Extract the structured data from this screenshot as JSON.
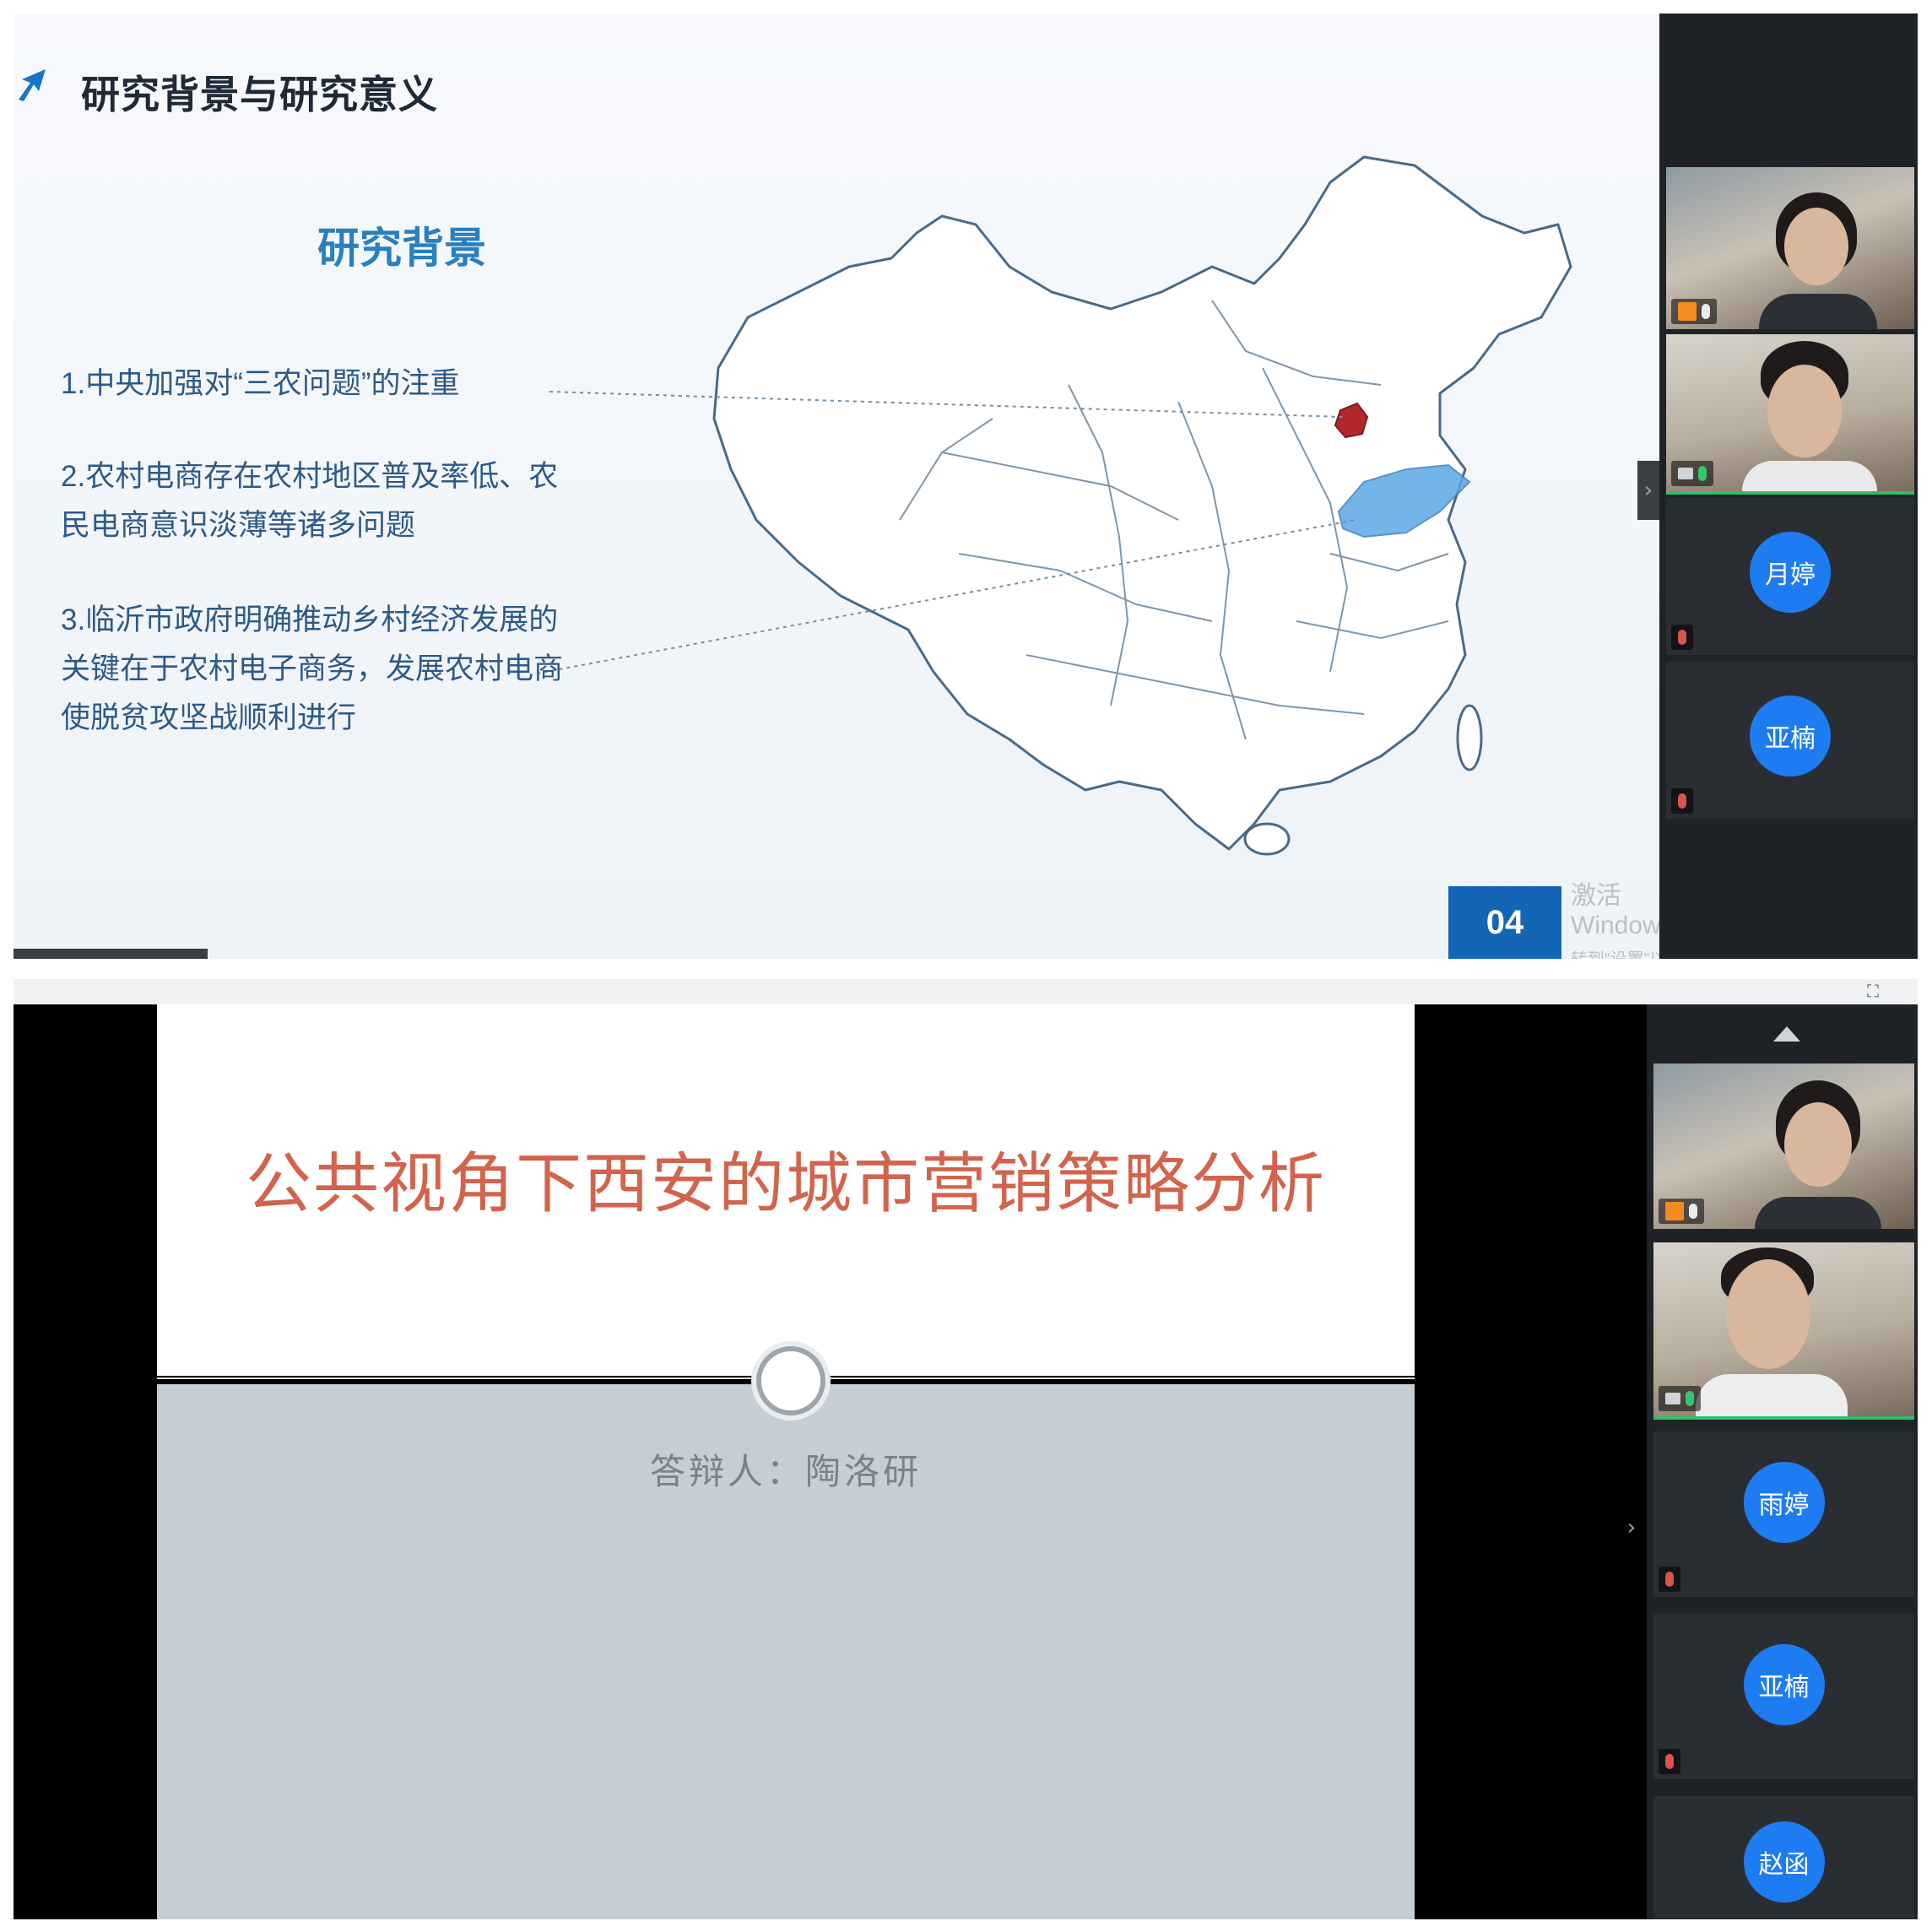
{
  "top_screen": {
    "slide": {
      "title": "研究背景与研究意义",
      "section_title": "研究背景",
      "bullets": [
        "1.中央加强对“三农问题”的注重",
        "2.农村电商存在农村地区普及率低、农民电商意识淡薄等诸多问题",
        "3.临沂市政府明确推动乡村经济发展的关键在于农村电子商务，发展农村电商使脱贫攻坚战顺利进行"
      ],
      "page_number": "04",
      "map_highlight_color": "#b3262e",
      "map_region_color": "#5ea8e6"
    },
    "watermark": {
      "line1": "激活 Windows",
      "line2": "转到“设置”以激活 Windows。"
    },
    "participants": [
      {
        "type": "video",
        "host": true
      },
      {
        "type": "video",
        "host": false
      },
      {
        "type": "avatar",
        "avatar_text": "月婷"
      },
      {
        "type": "avatar",
        "avatar_text": "亚楠"
      }
    ]
  },
  "bottom_screen": {
    "slide": {
      "title": "公共视角下西安的城市营销策略分析",
      "defender": "答辩人：陶洛研"
    },
    "participants": [
      {
        "type": "video",
        "host": true
      },
      {
        "type": "video",
        "host": false
      },
      {
        "type": "avatar",
        "avatar_text": "雨婷"
      },
      {
        "type": "avatar",
        "avatar_text": "亚楠"
      },
      {
        "type": "avatar",
        "avatar_text": "赵函"
      }
    ]
  },
  "colors": {
    "accent_blue": "#1565b5",
    "avatar_blue": "#1e7cf2",
    "title_red": "#d2634c",
    "speaking_green": "#2fbf6a"
  }
}
